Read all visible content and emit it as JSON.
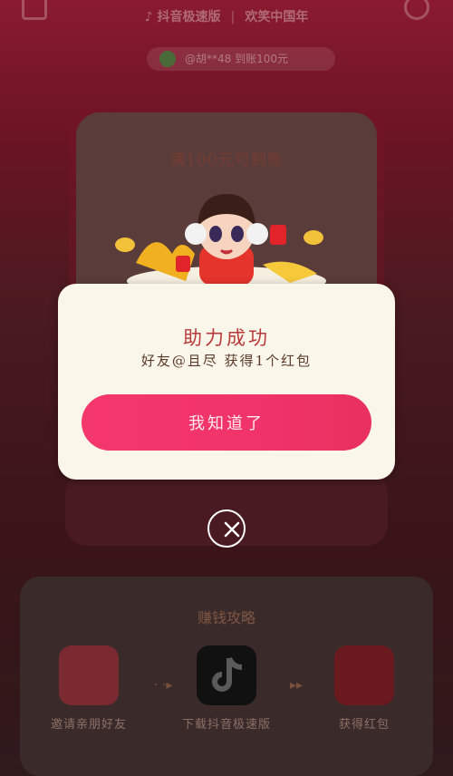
{
  "header": {
    "brand": "抖音极速版",
    "slogan": "欢笑中国年"
  },
  "ticker": {
    "text": "@胡**48 到账100元"
  },
  "card": {
    "title": "满100元可到账"
  },
  "dialog": {
    "title": "助力成功",
    "message": "好友@且尽 获得1个红包",
    "ok_label": "我知道了"
  },
  "strategy": {
    "title": "赚钱攻略",
    "items": [
      {
        "label": "邀请亲朋好友",
        "icon": "invite-friends-icon",
        "color": "#b23a3f"
      },
      {
        "label": "下载抖音极速版",
        "icon": "douyin-app-icon",
        "color": "#000000"
      },
      {
        "label": "获得红包",
        "icon": "red-envelope-icon",
        "color": "#b0282c"
      }
    ]
  },
  "colors": {
    "accent": "#f4376c",
    "dialog_bg": "#fbf6ea",
    "title_red": "#b83a3a"
  }
}
